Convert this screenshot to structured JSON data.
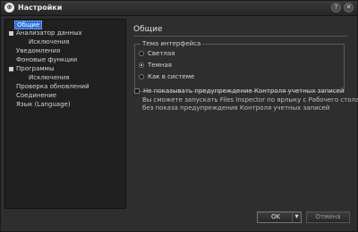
{
  "window": {
    "title": "Настройки",
    "app_icon_glyph": "⊕",
    "help_glyph": "?",
    "close_glyph": "✕"
  },
  "sidebar": {
    "items": [
      {
        "label": "Общие",
        "selected": true
      },
      {
        "label": "Анализатор данных",
        "expandable": true
      },
      {
        "label": "Исключения",
        "child": true
      },
      {
        "label": "Уведомления"
      },
      {
        "label": "Фоновые функции"
      },
      {
        "label": "Программы",
        "expandable": true
      },
      {
        "label": "Исключения",
        "child": true
      },
      {
        "label": "Проверка обновлений"
      },
      {
        "label": "Соединение"
      },
      {
        "label": "Язык (Language)"
      }
    ]
  },
  "main": {
    "section_title": "Общие",
    "theme_group": {
      "title": "Тема интерфейса",
      "options": [
        {
          "label": "Светлая",
          "checked": false
        },
        {
          "label": "Темная",
          "checked": true
        },
        {
          "label": "Как в системе",
          "checked": false
        }
      ]
    },
    "uac_checkbox": {
      "label": "Не показывать предупреждение Контроля учетных записей",
      "checked": false,
      "description_line1": "Вы сможете запускать Files Inspector по ярлыку с Рабочего стола",
      "description_line2": "без показа предупреждения Контроля учетных записей"
    }
  },
  "footer": {
    "ok_label": "OK",
    "ok_dropdown_glyph": "▼",
    "cancel_label": "Отмена"
  }
}
